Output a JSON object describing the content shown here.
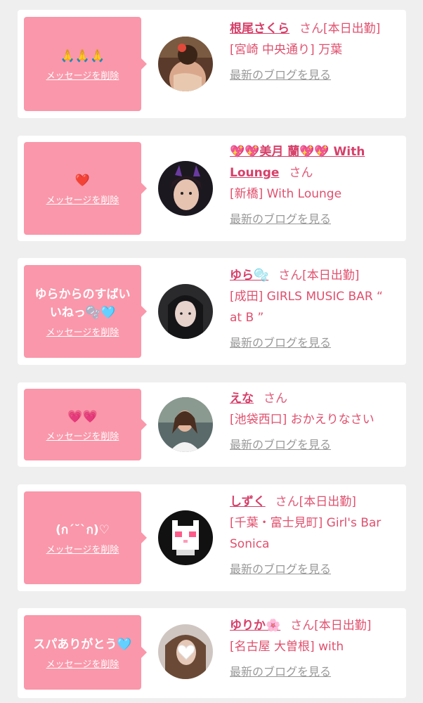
{
  "delete_label": "メッセージを削除",
  "san_label": "さん",
  "blog_label": "最新のブログを見る",
  "colors": {
    "bubble": "#fa97aa",
    "name": "#d6406a",
    "info": "#e0506e",
    "link": "#999999"
  },
  "cards": [
    {
      "message": "🙏🙏🙏",
      "name": "根尾さくら",
      "status": "[本日出勤]",
      "shop": "[宮崎 中央通り] 万葉",
      "avatar": "photo-woman-kimono-back"
    },
    {
      "message": "❤️",
      "name": "💖💖美月 蘭💖💖 With Lounge",
      "status": "",
      "shop": "[新橋] With Lounge",
      "avatar": "photo-woman-horns"
    },
    {
      "message": "ゆらからのすばいいねっ🫧🩵",
      "name": "ゆら🫧",
      "status": "[本日出勤]",
      "shop": "[成田] GIRLS MUSIC BAR “ at B ”",
      "avatar": "photo-woman-dark-hair"
    },
    {
      "message": "💗💗",
      "name": "えな",
      "status": "",
      "shop": "[池袋西口] おかえりなさい",
      "avatar": "photo-woman-white-top"
    },
    {
      "message": "(ก´˘`ก)♡",
      "name": "しずく",
      "status": "[本日出勤]",
      "shop": "[千葉・富士見町] Girl's Bar Sonica",
      "avatar": "pixel-cat-heart-eyes"
    },
    {
      "message": "スパありがとう🩵",
      "name": "ゆりか🌸",
      "status": "[本日出勤]",
      "shop": "[名古屋 大曽根] with",
      "avatar": "photo-woman-heart-sticker"
    }
  ]
}
